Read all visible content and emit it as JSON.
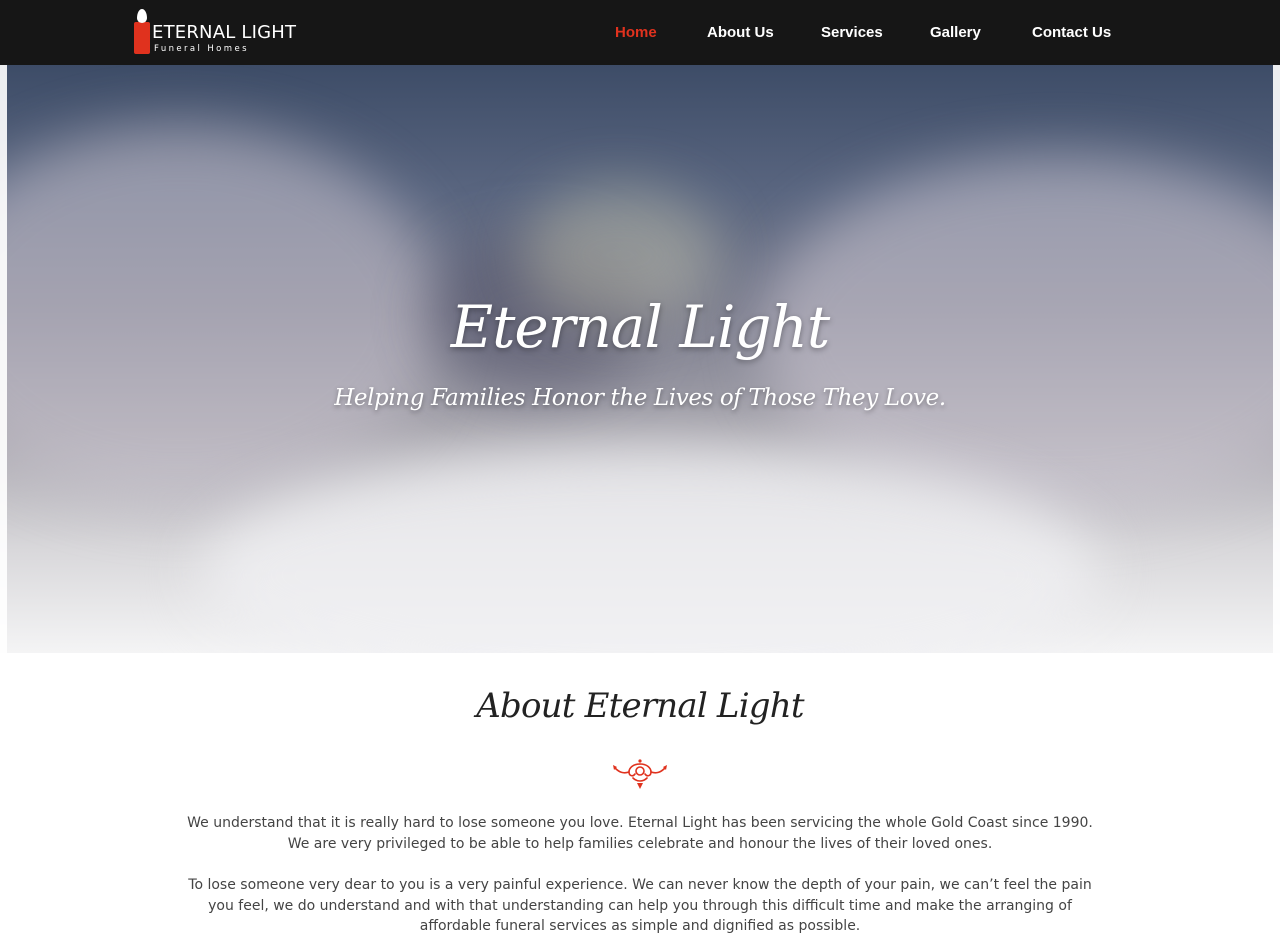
{
  "brand": {
    "name": "ETERNAL LIGHT",
    "tagline": "Funeral Homes",
    "accent_color": "#e0321e",
    "icon": "candle-icon"
  },
  "nav": {
    "items": [
      {
        "label": "Home",
        "active": true
      },
      {
        "label": "About Us",
        "active": false
      },
      {
        "label": "Services",
        "active": false
      },
      {
        "label": "Gallery",
        "active": false
      },
      {
        "label": "Contact Us",
        "active": false
      }
    ]
  },
  "hero": {
    "title": "Eternal Light",
    "subtitle": "Helping Families Honor the Lives of Those They Love."
  },
  "about": {
    "title": "About Eternal Light",
    "ornament_icon": "flourish-ornament-icon",
    "paragraphs": [
      "We understand that it is really hard to lose someone you love. Eternal Light has been servicing the whole Gold Coast since 1990. We are very privileged to be able to help families celebrate and honour the lives of their loved ones.",
      "To lose someone very dear to you is a very painful experience. We can never know the depth of your pain, we can’t feel the pain you feel, we do understand and with that understanding can help you through this difficult time and make the arranging of affordable funeral services as simple and dignified as possible."
    ]
  }
}
